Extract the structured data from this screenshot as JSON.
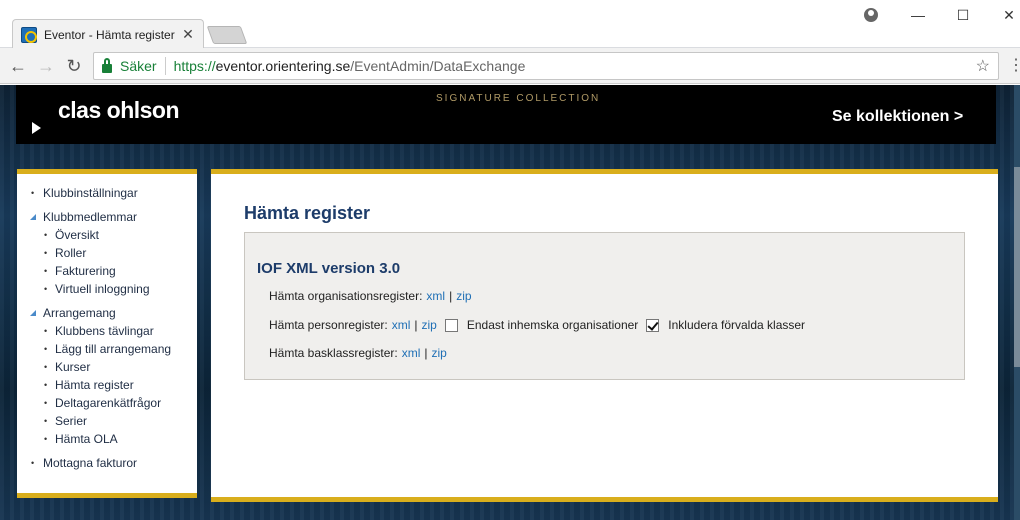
{
  "browser": {
    "tab_title": "Eventor - Hämta register",
    "tab_close": "✕",
    "url_scheme": "https://",
    "url_host": "eventor.orientering.se",
    "url_path": "/EventAdmin/DataExchange",
    "secure_label": "Säker",
    "minimize": "—",
    "maximize": "☐",
    "close": "✕",
    "back": "←",
    "forward": "→",
    "reload": "↻",
    "star": "☆",
    "menu": "⋮"
  },
  "banner": {
    "brand": "clas ohlson",
    "tagline": "SIGNATURE COLLECTION",
    "cta": "Se kollektionen >"
  },
  "sidebar": {
    "items": [
      {
        "label": "Klubbinställningar",
        "type": "bullet"
      },
      {
        "label": "Klubbmedlemmar",
        "type": "open",
        "children": [
          "Översikt",
          "Roller",
          "Fakturering",
          "Virtuell inloggning"
        ]
      },
      {
        "label": "Arrangemang",
        "type": "open",
        "children": [
          "Klubbens tävlingar",
          "Lägg till arrangemang",
          "Kurser",
          "Hämta register",
          "Deltagarenkätfrågor",
          "Serier",
          "Hämta OLA"
        ]
      },
      {
        "label": "Mottagna fakturor",
        "type": "bullet"
      }
    ]
  },
  "main": {
    "title": "Hämta register",
    "section_title": "IOF XML version 3.0",
    "org_label": "Hämta organisationsregister:",
    "person_label": "Hämta personregister:",
    "basklass_label": "Hämta basklassregister:",
    "xml": "xml",
    "zip": "zip",
    "pipe": "|",
    "only_domestic_label": "Endast inhemska organisationer",
    "only_domestic_checked": false,
    "include_default_label": "Inkludera förvalda klasser",
    "include_default_checked": true
  },
  "colors": {
    "accent_gold": "#d9ae1c",
    "heading_blue": "#1d3c6a",
    "link_blue": "#1f6fb5"
  }
}
